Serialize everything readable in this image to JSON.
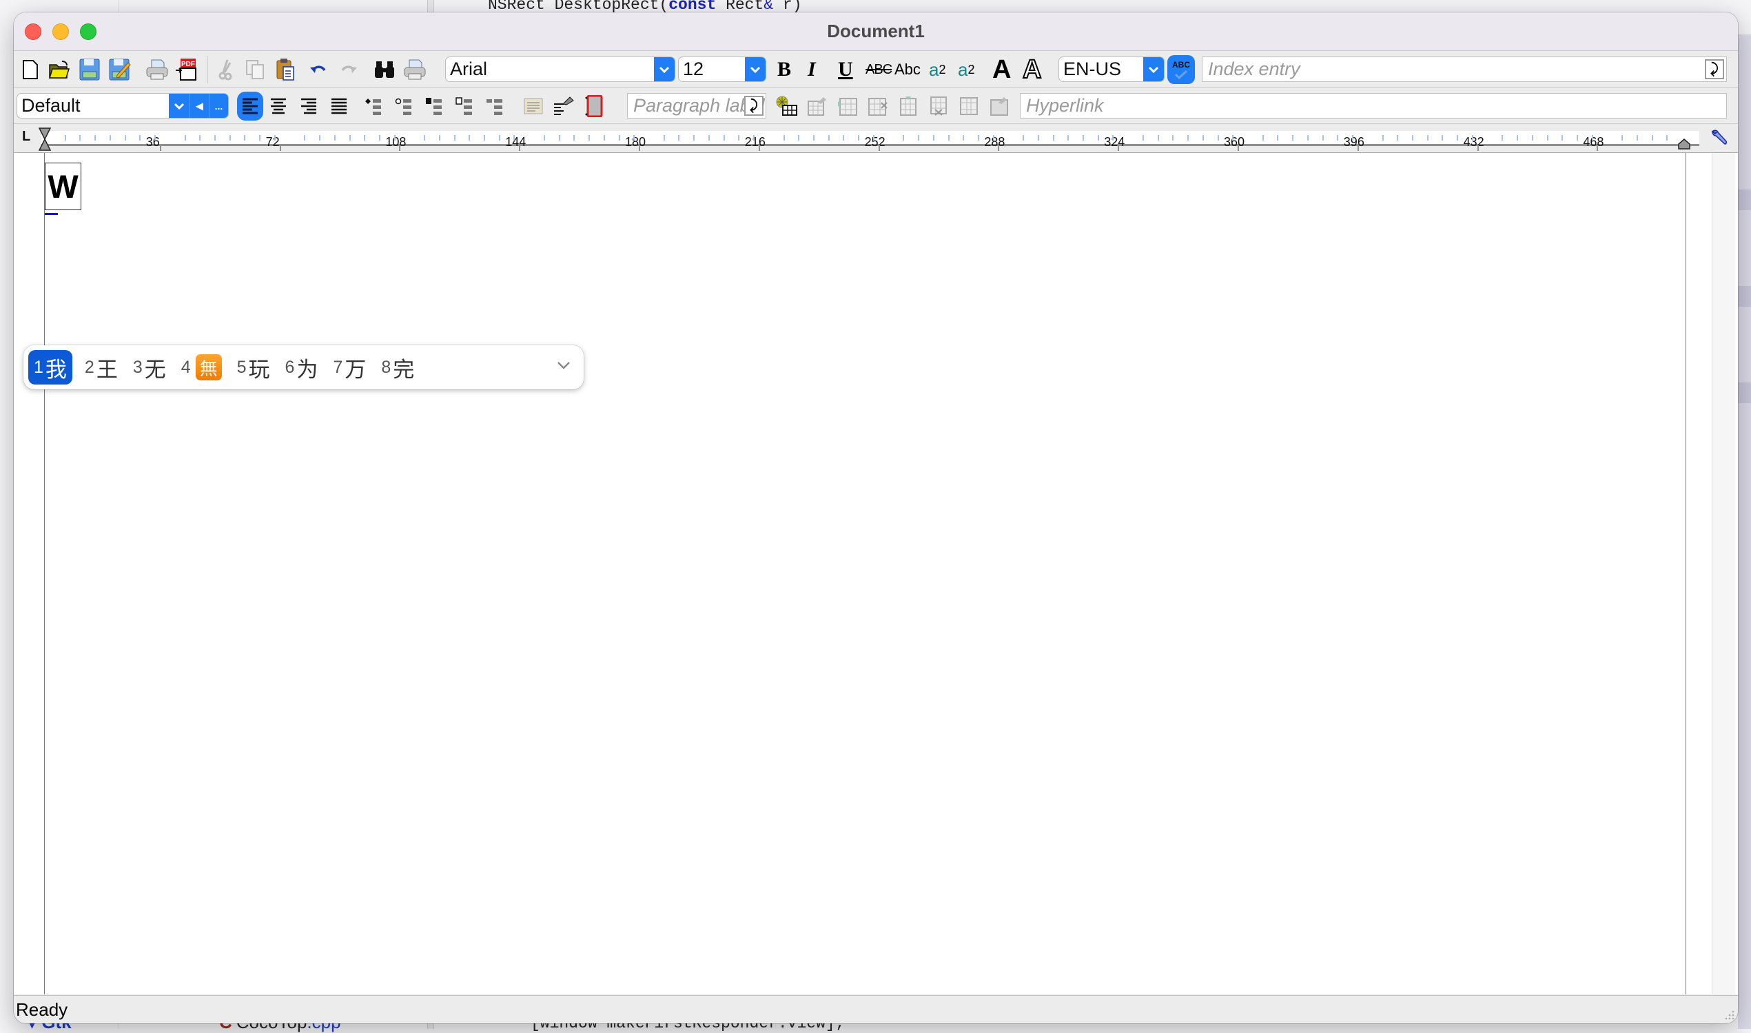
{
  "background": {
    "code_top": {
      "plain1": "NSRect DesktopRect(",
      "kw": "const",
      "plain2": " Rect",
      "amp": "&",
      "plain3": " r)"
    },
    "code_bottom": "[window makeFirstResponder:view];",
    "file_label": {
      "icon": "C",
      "name": "CocoTop",
      "ext": ".cpp"
    },
    "tree_label": "▾ Gtk"
  },
  "window": {
    "title": "Document1",
    "traffic_lights": [
      "close",
      "minimize",
      "zoom"
    ]
  },
  "toolbar1": {
    "icons": [
      "new-document",
      "open-folder",
      "save",
      "save-as",
      "print",
      "export-pdf",
      "cut",
      "copy",
      "paste",
      "undo",
      "redo",
      "find",
      "print-preview"
    ],
    "font_name": "Arial",
    "font_size": "12",
    "format_buttons": {
      "bold": "B",
      "italic": "I",
      "underline": "U",
      "strikethrough": "ABC",
      "small_caps": "Abc",
      "superscript_base": "a",
      "superscript": "2",
      "subscript_base": "a",
      "subscript": "2",
      "text_color": "A",
      "highlight": "A"
    },
    "language": "EN-US",
    "spellcheck_label": "ABC",
    "index_entry_placeholder": "Index entry",
    "go_glyph": "⤸"
  },
  "toolbar2": {
    "style": "Default",
    "style_prev": "◂",
    "style_more": "...",
    "align": [
      "left",
      "center",
      "right",
      "justify"
    ],
    "align_active": "left",
    "list_icons": [
      "bullet-list",
      "circle-list",
      "square-list",
      "hollow-square-list",
      "numbered-list",
      "paragraph-frame",
      "paragraph-format",
      "page-frame"
    ],
    "paragraph_label_placeholder": "Paragraph label",
    "go_glyph": "⤸",
    "table_icons": [
      "insert-table",
      "table-properties",
      "insert-row",
      "delete-row",
      "insert-column",
      "delete-column",
      "split-cells",
      "cell-properties"
    ],
    "hyperlink_placeholder": "Hyperlink"
  },
  "ruler": {
    "corner": "L",
    "labels": [
      "36",
      "72",
      "108",
      "144",
      "180",
      "216",
      "252",
      "288",
      "324",
      "360",
      "396",
      "432",
      "468"
    ],
    "wrench_glyph": "🔧"
  },
  "document": {
    "composed_text": "W"
  },
  "ime": {
    "candidates": [
      {
        "n": "1",
        "text": "我",
        "selected": true
      },
      {
        "n": "2",
        "text": "王"
      },
      {
        "n": "3",
        "text": "无"
      },
      {
        "n": "4",
        "text": "無",
        "emoji": true
      },
      {
        "n": "5",
        "text": "玩"
      },
      {
        "n": "6",
        "text": "为"
      },
      {
        "n": "7",
        "text": "万"
      },
      {
        "n": "8",
        "text": "完"
      }
    ],
    "selected_color": "#0d5ad7"
  },
  "status": {
    "text": "Ready"
  },
  "colors": {
    "accent": "#1f7ef5",
    "close": "#fe5f57",
    "minimize": "#febc2e",
    "zoom": "#28c840"
  }
}
